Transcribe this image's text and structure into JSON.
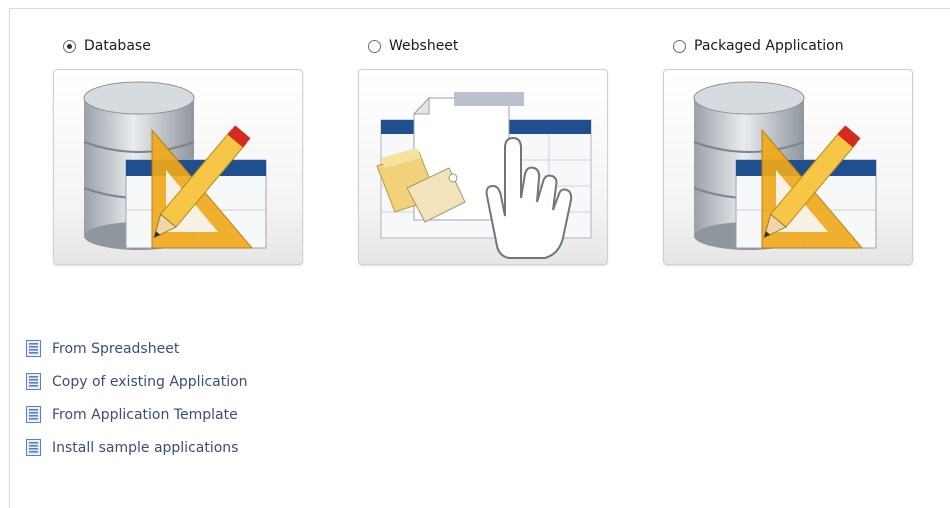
{
  "options": [
    {
      "label": "Database",
      "selected": true,
      "icon": "database-pencil-icon"
    },
    {
      "label": "Websheet",
      "selected": false,
      "icon": "websheet-hand-icon"
    },
    {
      "label": "Packaged Application",
      "selected": false,
      "icon": "packaged-database-pencil-icon"
    }
  ],
  "links": [
    {
      "label": "From Spreadsheet",
      "icon": "document-icon"
    },
    {
      "label": "Copy of existing Application",
      "icon": "document-icon"
    },
    {
      "label": "From Application Template",
      "icon": "document-icon"
    },
    {
      "label": "Install sample applications",
      "icon": "document-icon"
    }
  ],
  "colors": {
    "link_text": "#3a4f73",
    "doc_icon": "#5b7fc4",
    "window_bar": "#1f4f8f",
    "triangle": "#f0a91c",
    "pencil_tip": "#d42a1f"
  }
}
